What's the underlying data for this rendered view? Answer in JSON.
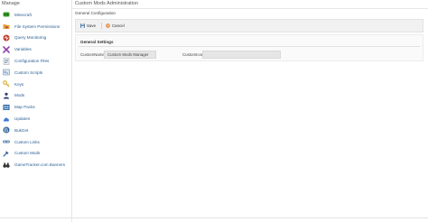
{
  "sidebar": {
    "title": "Manage",
    "items": [
      {
        "label": "Minecraft",
        "icon": "minecraft-icon"
      },
      {
        "label": "File System Permissions",
        "icon": "folder-icon"
      },
      {
        "label": "Query Monitoring",
        "icon": "query-monitoring-icon"
      },
      {
        "label": "Variables",
        "icon": "variables-icon"
      },
      {
        "label": "Configuration Files",
        "icon": "configuration-files-icon"
      },
      {
        "label": "Custom Scripts",
        "icon": "custom-scripts-icon"
      },
      {
        "label": "Keys",
        "icon": "key-icon"
      },
      {
        "label": "Mods",
        "icon": "mods-icon"
      },
      {
        "label": "Map Packs",
        "icon": "map-packs-icon"
      },
      {
        "label": "Updates",
        "icon": "cloud-icon"
      },
      {
        "label": "BukGet",
        "icon": "bukget-icon"
      },
      {
        "label": "Custom Links",
        "icon": "link-icon"
      },
      {
        "label": "Custom Mods",
        "icon": "custom-mods-icon"
      },
      {
        "label": "GameTracker.com Banners",
        "icon": "binoculars-icon"
      }
    ]
  },
  "header": {
    "title": "Custom Mods Administration",
    "breadcrumb": "General Configuration"
  },
  "toolbar": {
    "save_label": "Save",
    "cancel_label": "Cancel"
  },
  "settings": {
    "title": "General Settings",
    "custom_name_label": "CustomName",
    "custom_name_value": "Custom Mods Manager",
    "custom_icon_label": "CustomIcon",
    "custom_icon_value": ""
  },
  "colors": {
    "link": "#2a5f96",
    "toolbar_bg": "#f1f1f1",
    "input_bg": "#e6e6e6"
  }
}
